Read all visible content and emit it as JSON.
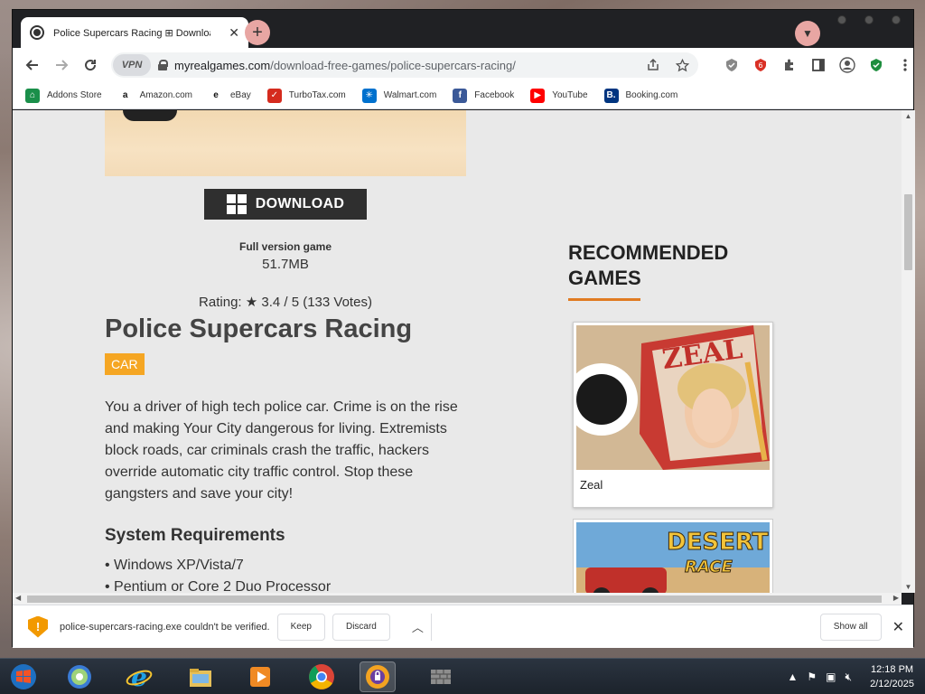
{
  "browser": {
    "tab_title": "Police Supercars Racing ⊞ Download Fre",
    "url_host": "myrealgames.com",
    "url_path": "/download-free-games/police-supercars-racing/",
    "vpn_label": "VPN"
  },
  "bookmarks": [
    {
      "label": "Addons Store",
      "icon": "addons-icon",
      "color": "#1a8f4a",
      "glyph": "⌂"
    },
    {
      "label": "Amazon.com",
      "icon": "amazon-icon",
      "color": "#ffffff",
      "glyph": "a"
    },
    {
      "label": "eBay",
      "icon": "ebay-icon",
      "color": "#ffffff",
      "glyph": "e"
    },
    {
      "label": "TurboTax.com",
      "icon": "turbotax-icon",
      "color": "#d52b1e",
      "glyph": "✓"
    },
    {
      "label": "Walmart.com",
      "icon": "walmart-icon",
      "color": "#0071ce",
      "glyph": "✳"
    },
    {
      "label": "Facebook",
      "icon": "facebook-icon",
      "color": "#3b5998",
      "glyph": "f"
    },
    {
      "label": "YouTube",
      "icon": "youtube-icon",
      "color": "#ff0000",
      "glyph": "▶"
    },
    {
      "label": "Booking.com",
      "icon": "booking-icon",
      "color": "#003580",
      "glyph": "B."
    }
  ],
  "page": {
    "download_label": "DOWNLOAD",
    "full_version": "Full version game",
    "file_size": "51.7MB",
    "rating": "Rating: ★ 3.4 / 5 (133 Votes)",
    "title": "Police Supercars Racing",
    "category": "CAR",
    "description": "You a driver of high tech police car. Crime is on the rise and making Your City dangerous for living. Extremists block roads, car criminals crash the traffic, hackers override automatic city traffic control. Stop these gangsters and save your city!",
    "sysreq_title": "System Requirements",
    "sysreq": [
      "• Windows XP/Vista/7",
      "• Pentium or Core 2 Duo Processor"
    ],
    "recommended_title": "RECOMMENDED GAMES",
    "recommended": [
      {
        "name": "Zeal"
      },
      {
        "name": ""
      }
    ],
    "accent_color": "#f5a623"
  },
  "download_bar": {
    "message": "police-supercars-racing.exe couldn't be verified.",
    "keep": "Keep",
    "discard": "Discard",
    "show_all": "Show all"
  },
  "taskbar": {
    "time": "12:18 PM",
    "date": "2/12/2025"
  }
}
